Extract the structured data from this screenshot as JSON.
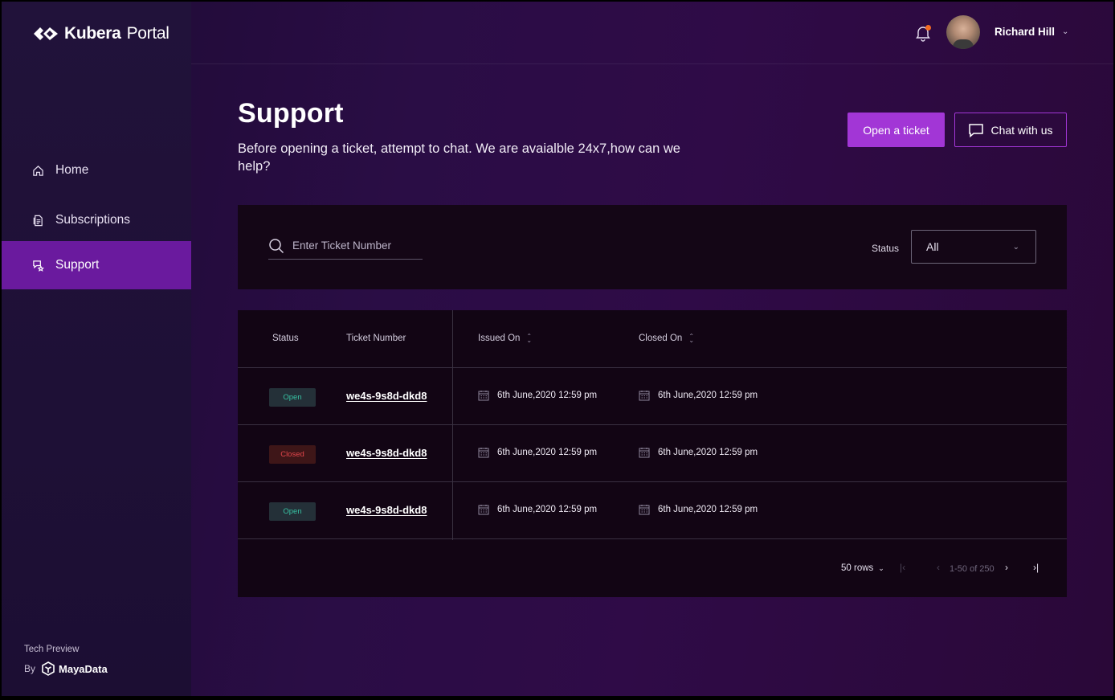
{
  "brand": {
    "name_bold": "Kubera",
    "name_light": "Portal"
  },
  "sidebar": {
    "items": [
      {
        "label": "Home",
        "icon": "home-icon",
        "active": false
      },
      {
        "label": "Subscriptions",
        "icon": "document-icon",
        "active": false
      },
      {
        "label": "Support",
        "icon": "support-icon",
        "active": true
      }
    ],
    "footer": {
      "preview": "Tech Preview",
      "by": "By",
      "company": "MayaData"
    }
  },
  "topbar": {
    "user_name": "Richard Hill",
    "notification": true
  },
  "page": {
    "title": "Support",
    "subtitle": "Before opening a ticket, attempt to chat. We are avaialble 24x7,how can we help?",
    "open_ticket_label": "Open a ticket",
    "chat_label": "Chat with us"
  },
  "filter": {
    "search_placeholder": "Enter Ticket Number",
    "status_label": "Status",
    "status_value": "All"
  },
  "table": {
    "columns": {
      "status": "Status",
      "ticket": "Ticket Number",
      "issued": "Issued On",
      "closed": "Closed On"
    },
    "rows": [
      {
        "status": "Open",
        "ticket": "we4s-9s8d-dkd8",
        "issued": "6th June,2020 12:59 pm",
        "closed": "6th June,2020 12:59 pm"
      },
      {
        "status": "Closed",
        "ticket": "we4s-9s8d-dkd8",
        "issued": "6th June,2020 12:59 pm",
        "closed": "6th June,2020 12:59 pm"
      },
      {
        "status": "Open",
        "ticket": "we4s-9s8d-dkd8",
        "issued": "6th June,2020 12:59 pm",
        "closed": "6th June,2020 12:59 pm"
      }
    ]
  },
  "pagination": {
    "rows_label": "50 rows",
    "range": "1-50 of 250"
  },
  "colors": {
    "accent": "#a236d6",
    "active_nav": "#6a1a9e",
    "open": "#38c2a3",
    "closed": "#e2464b"
  }
}
